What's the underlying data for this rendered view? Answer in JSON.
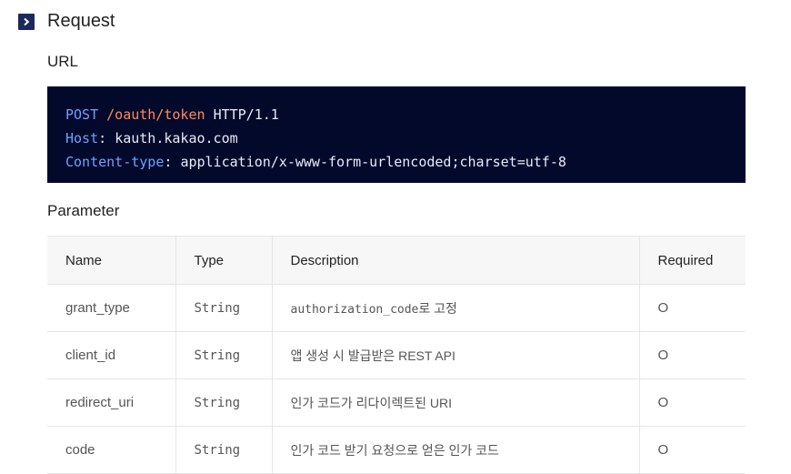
{
  "section": {
    "title": "Request",
    "icon": "chevron-right-icon"
  },
  "url_section": {
    "title": "URL",
    "method": "POST",
    "path": "/oauth/token",
    "protocol": "HTTP/1.1",
    "host_key": "Host",
    "host_value": "kauth.kakao.com",
    "content_type_key": "Content-type",
    "content_type_value": "application/x-www-form-urlencoded;charset=utf-8"
  },
  "parameter_section": {
    "title": "Parameter",
    "headers": [
      "Name",
      "Type",
      "Description",
      "Required"
    ],
    "rows": [
      {
        "name": "grant_type",
        "type": "String",
        "desc_code": "authorization_code",
        "desc_text": "로 고정",
        "required": "O"
      },
      {
        "name": "client_id",
        "type": "String",
        "desc_code": "",
        "desc_text": "앱 생성 시 발급받은 REST API",
        "required": "O"
      },
      {
        "name": "redirect_uri",
        "type": "String",
        "desc_code": "",
        "desc_text": "인가 코드가 리다이렉트된 URI",
        "required": "O"
      },
      {
        "name": "code",
        "type": "String",
        "desc_code": "",
        "desc_text": "인가 코드 받기 요청으로 얻은 인가 코드",
        "required": "O"
      }
    ]
  },
  "colors": {
    "code_bg": "#03092b",
    "keyword_blue": "#6ea2ff",
    "path_orange": "#ff8a5c",
    "header_icon_bg": "#1b2a5c"
  }
}
